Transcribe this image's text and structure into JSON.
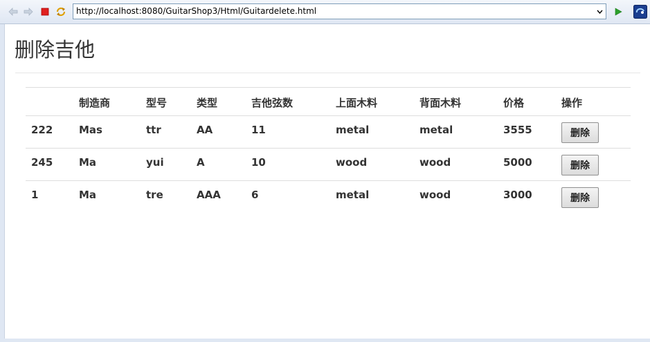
{
  "browser": {
    "url": "http://localhost:8080/GuitarShop3/Html/Guitardelete.html",
    "back_icon": "back-arrow-icon",
    "forward_icon": "forward-arrow-icon",
    "stop_icon": "stop-icon",
    "refresh_icon": "refresh-icon",
    "go_icon": "go-arrow-icon",
    "extension_icon": "browser-logo-icon"
  },
  "page": {
    "title": "删除吉他"
  },
  "table": {
    "headers": [
      "",
      "制造商",
      "型号",
      "类型",
      "吉他弦数",
      "上面木料",
      "背面木料",
      "价格",
      "操作"
    ],
    "rows": [
      {
        "id": "222",
        "builder": "Mas",
        "model": "ttr",
        "type": "AA",
        "strings": "11",
        "top_wood": "metal",
        "back_wood": "metal",
        "price": "3555",
        "action": "删除"
      },
      {
        "id": "245",
        "builder": "Ma",
        "model": "yui",
        "type": "A",
        "strings": "10",
        "top_wood": "wood",
        "back_wood": "wood",
        "price": "5000",
        "action": "删除"
      },
      {
        "id": "1",
        "builder": "Ma",
        "model": "tre",
        "type": "AAA",
        "strings": "6",
        "top_wood": "metal",
        "back_wood": "wood",
        "price": "3000",
        "action": "删除"
      }
    ]
  }
}
